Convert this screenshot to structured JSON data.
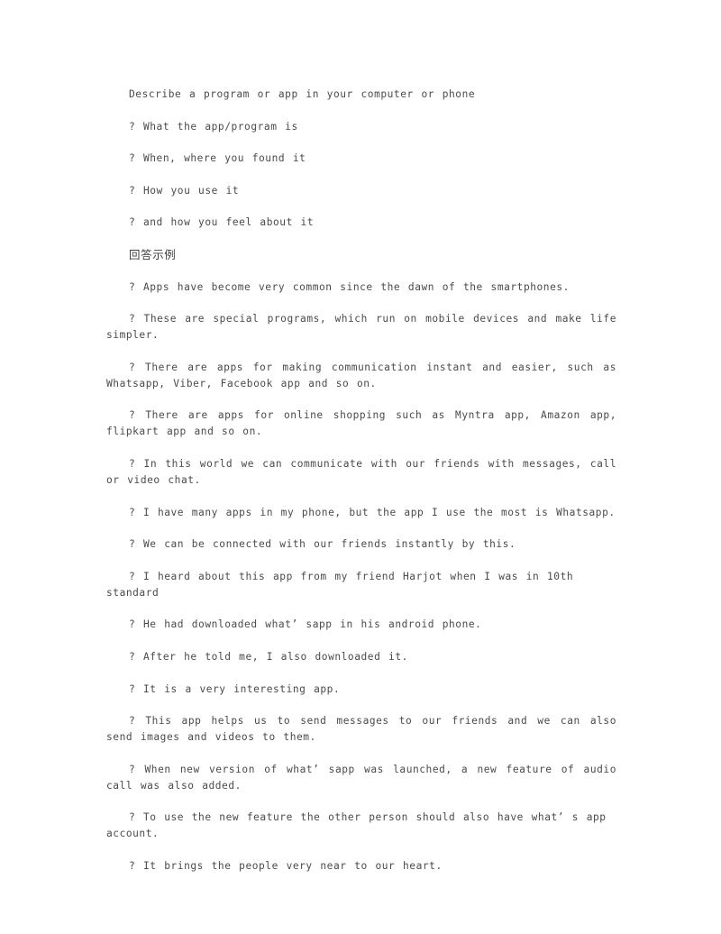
{
  "document": {
    "title_line": "Describe a program or app in your computer or phone",
    "prompts": [
      "? What the app/program is",
      "? When, where you found it",
      "? How you use it",
      "? and how you feel about it"
    ],
    "section_heading": "回答示例",
    "answers": [
      "? Apps have become very common since the dawn of the smartphones.",
      "? These are special programs, which run on mobile devices and make life simpler.",
      "? There are apps for making communication instant and easier, such as Whatsapp, Viber, Facebook app and so on.",
      "? There are apps for online shopping such as Myntra app, Amazon app, flipkart app and so on.",
      "? In this world we can communicate with our friends with messages, call or video chat.",
      "? I have many apps in my phone, but the app I use the most is Whatsapp.",
      "? We can be connected with our friends instantly by this.",
      "? I heard about this app from my friend Harjot when I was in 10th standard",
      "? He had downloaded what’ sapp in his android phone.",
      "? After he told me, I also downloaded it.",
      "? It is a very interesting app.",
      "? This app helps us to send messages to our friends and we can also send images and videos to them.",
      "? When new version of what’ sapp was launched, a new feature of audio call was also added.",
      "? To use the new feature the other person should also have what’ s app account.",
      "? It brings the people very near to our heart."
    ],
    "answers_multiline": [
      false,
      true,
      true,
      true,
      true,
      false,
      false,
      false,
      false,
      false,
      false,
      true,
      true,
      false,
      false
    ]
  }
}
